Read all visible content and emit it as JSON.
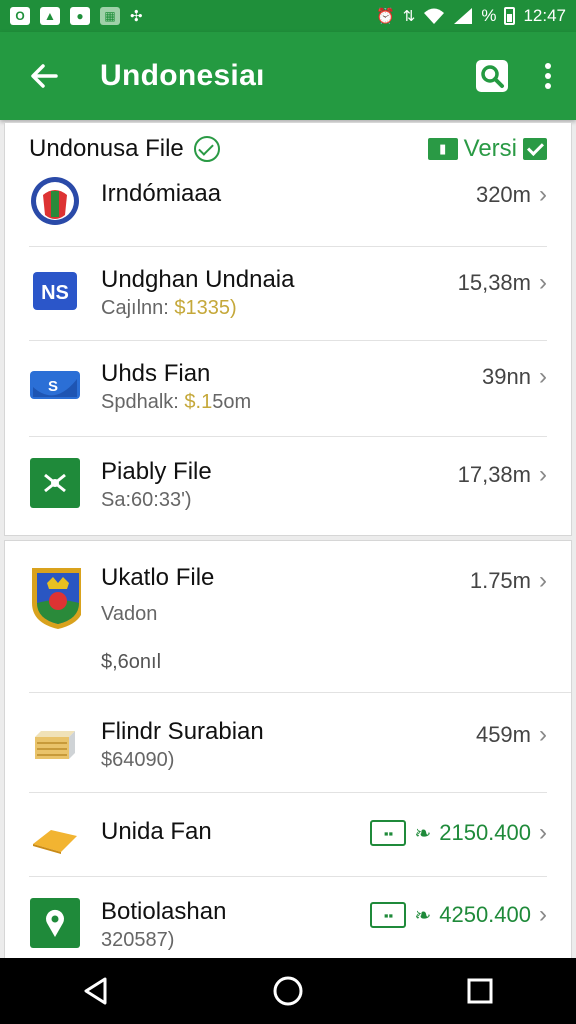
{
  "status_bar": {
    "time": "12:47",
    "battery_pct": "%"
  },
  "app_bar": {
    "title": "Undonesiaı"
  },
  "card1": {
    "title": "Undonusa File",
    "versi_label": "Versi",
    "rows": [
      {
        "title": "Irndómiaaa",
        "sub": "",
        "sub_amount": "",
        "size": "320m"
      },
      {
        "title": "Undghan Undnaia",
        "sub": "Cajılnn: ",
        "sub_amount": "$1335)",
        "size": "15,38m"
      },
      {
        "title": "Uhds Fian",
        "sub": "Spdhalk: ",
        "sub_amount": "$.1",
        "sub_tail": "5om",
        "size": "39nn"
      },
      {
        "title": "Piably File",
        "sub": "Sa:60:33'",
        "sub_amount": "",
        "sub_tail": ")",
        "size": "17,38m"
      }
    ]
  },
  "card2": {
    "rows": [
      {
        "title": "Ukatlo File",
        "sub": "Vadon",
        "extra": "$,6onıl",
        "size": "1.75m"
      },
      {
        "title": "Flindr Surabian",
        "sub": "$64090)",
        "size": "459m"
      },
      {
        "title": "Unida Fan",
        "price": "2150.400"
      },
      {
        "title": "Botiolashan",
        "sub": "320587)",
        "price": "4250.400"
      }
    ]
  },
  "colors": {
    "primary": "#249a41",
    "status": "#1f8f3a",
    "accent_gold": "#c5a83a"
  }
}
